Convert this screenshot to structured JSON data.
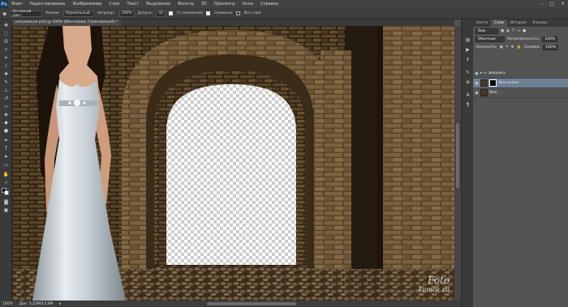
{
  "menubar": {
    "logo": "Ps",
    "items": [
      "Файл",
      "Редактирование",
      "Изображение",
      "Слои",
      "Текст",
      "Выделение",
      "Фильтр",
      "3D",
      "Просмотр",
      "Окно",
      "Справка"
    ],
    "window_buttons": [
      "–",
      "□",
      "×"
    ]
  },
  "options": {
    "mode_label": "Режим:",
    "brush_preset": "Основной цвет",
    "mode_value": "Нормальный",
    "opacity_label": "Непрозр.:",
    "opacity_value": "100%",
    "tolerance_label": "Допуск:",
    "tolerance_value": "32",
    "antialias_label": "Сглаживание",
    "contiguous_label": "Смежные",
    "all_layers_label": "Все слои"
  },
  "document": {
    "tab_title": "ресуаальня prof @ 100% (Фон копия, Слой-маска/8) *",
    "zoom": "100%",
    "doc_size": "Док: 3,52M/13,4M"
  },
  "panel": {
    "tabs": [
      "Кисти",
      "Слои",
      "История",
      "Каналы"
    ],
    "active_tab": "Слои",
    "filter_label": "Вид",
    "blend_mode": "Обычные",
    "opacity_label": "Непрозрачность:",
    "opacity_value": "100%",
    "lock_label": "Закрепить:",
    "fill_label": "Заливка:",
    "fill_value": "100%",
    "layers": [
      {
        "name": "Фон копия",
        "selected": true
      },
      {
        "name": "Фон",
        "selected": false
      }
    ],
    "group_name": "девушка"
  },
  "watermark": {
    "line1": "Foto",
    "line2": "komok.ru"
  },
  "colors": {
    "accent_selected_layer": "#6d7f93",
    "ui_dark": "#3a3a3a"
  }
}
